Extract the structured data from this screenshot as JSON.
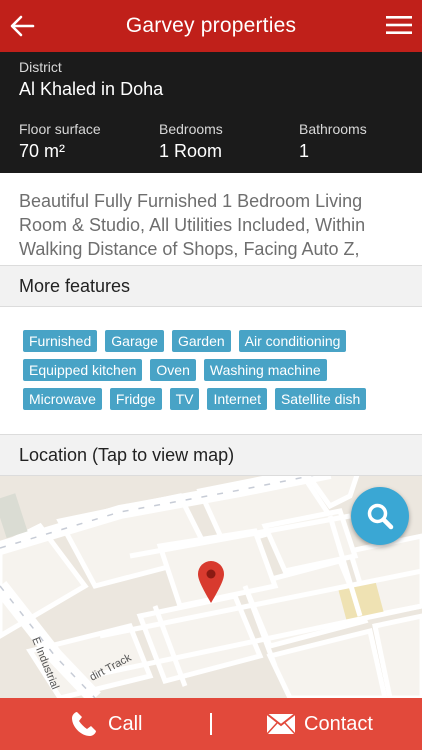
{
  "header": {
    "title": "Garvey properties",
    "back_icon": "arrow-left-icon",
    "menu_icon": "hamburger-menu-icon"
  },
  "summary": {
    "district_label": "District",
    "district_value": "Al Khaled in Doha",
    "floor_label": "Floor surface",
    "floor_value": "70 m²",
    "bedrooms_label": "Bedrooms",
    "bedrooms_value": "1 Room",
    "bathrooms_label": "Bathrooms",
    "bathrooms_value": "1"
  },
  "description": "Beautiful Fully Furnished 1 Bedroom Living Room & Studio, All Utilities Included, Within Walking Distance of Shops, Facing Auto Z,",
  "features": {
    "heading": "More features",
    "items": [
      "Furnished",
      "Garage",
      "Garden",
      "Air conditioning",
      "Equipped kitchen",
      "Oven",
      "Washing machine",
      "Microwave",
      "Fridge",
      "TV",
      "Internet",
      "Satellite dish"
    ]
  },
  "location": {
    "heading": "Location (Tap to view map)",
    "street_label_1": "dirt Track",
    "street_label_2": "E Industrial"
  },
  "actions": {
    "call_label": "Call",
    "contact_label": "Contact"
  },
  "colors": {
    "header": "#c0201a",
    "info_bg": "#1b1b1b",
    "tag": "#48a3c6",
    "bottom_bar": "#e2493b",
    "fab": "#3aa7d4"
  }
}
